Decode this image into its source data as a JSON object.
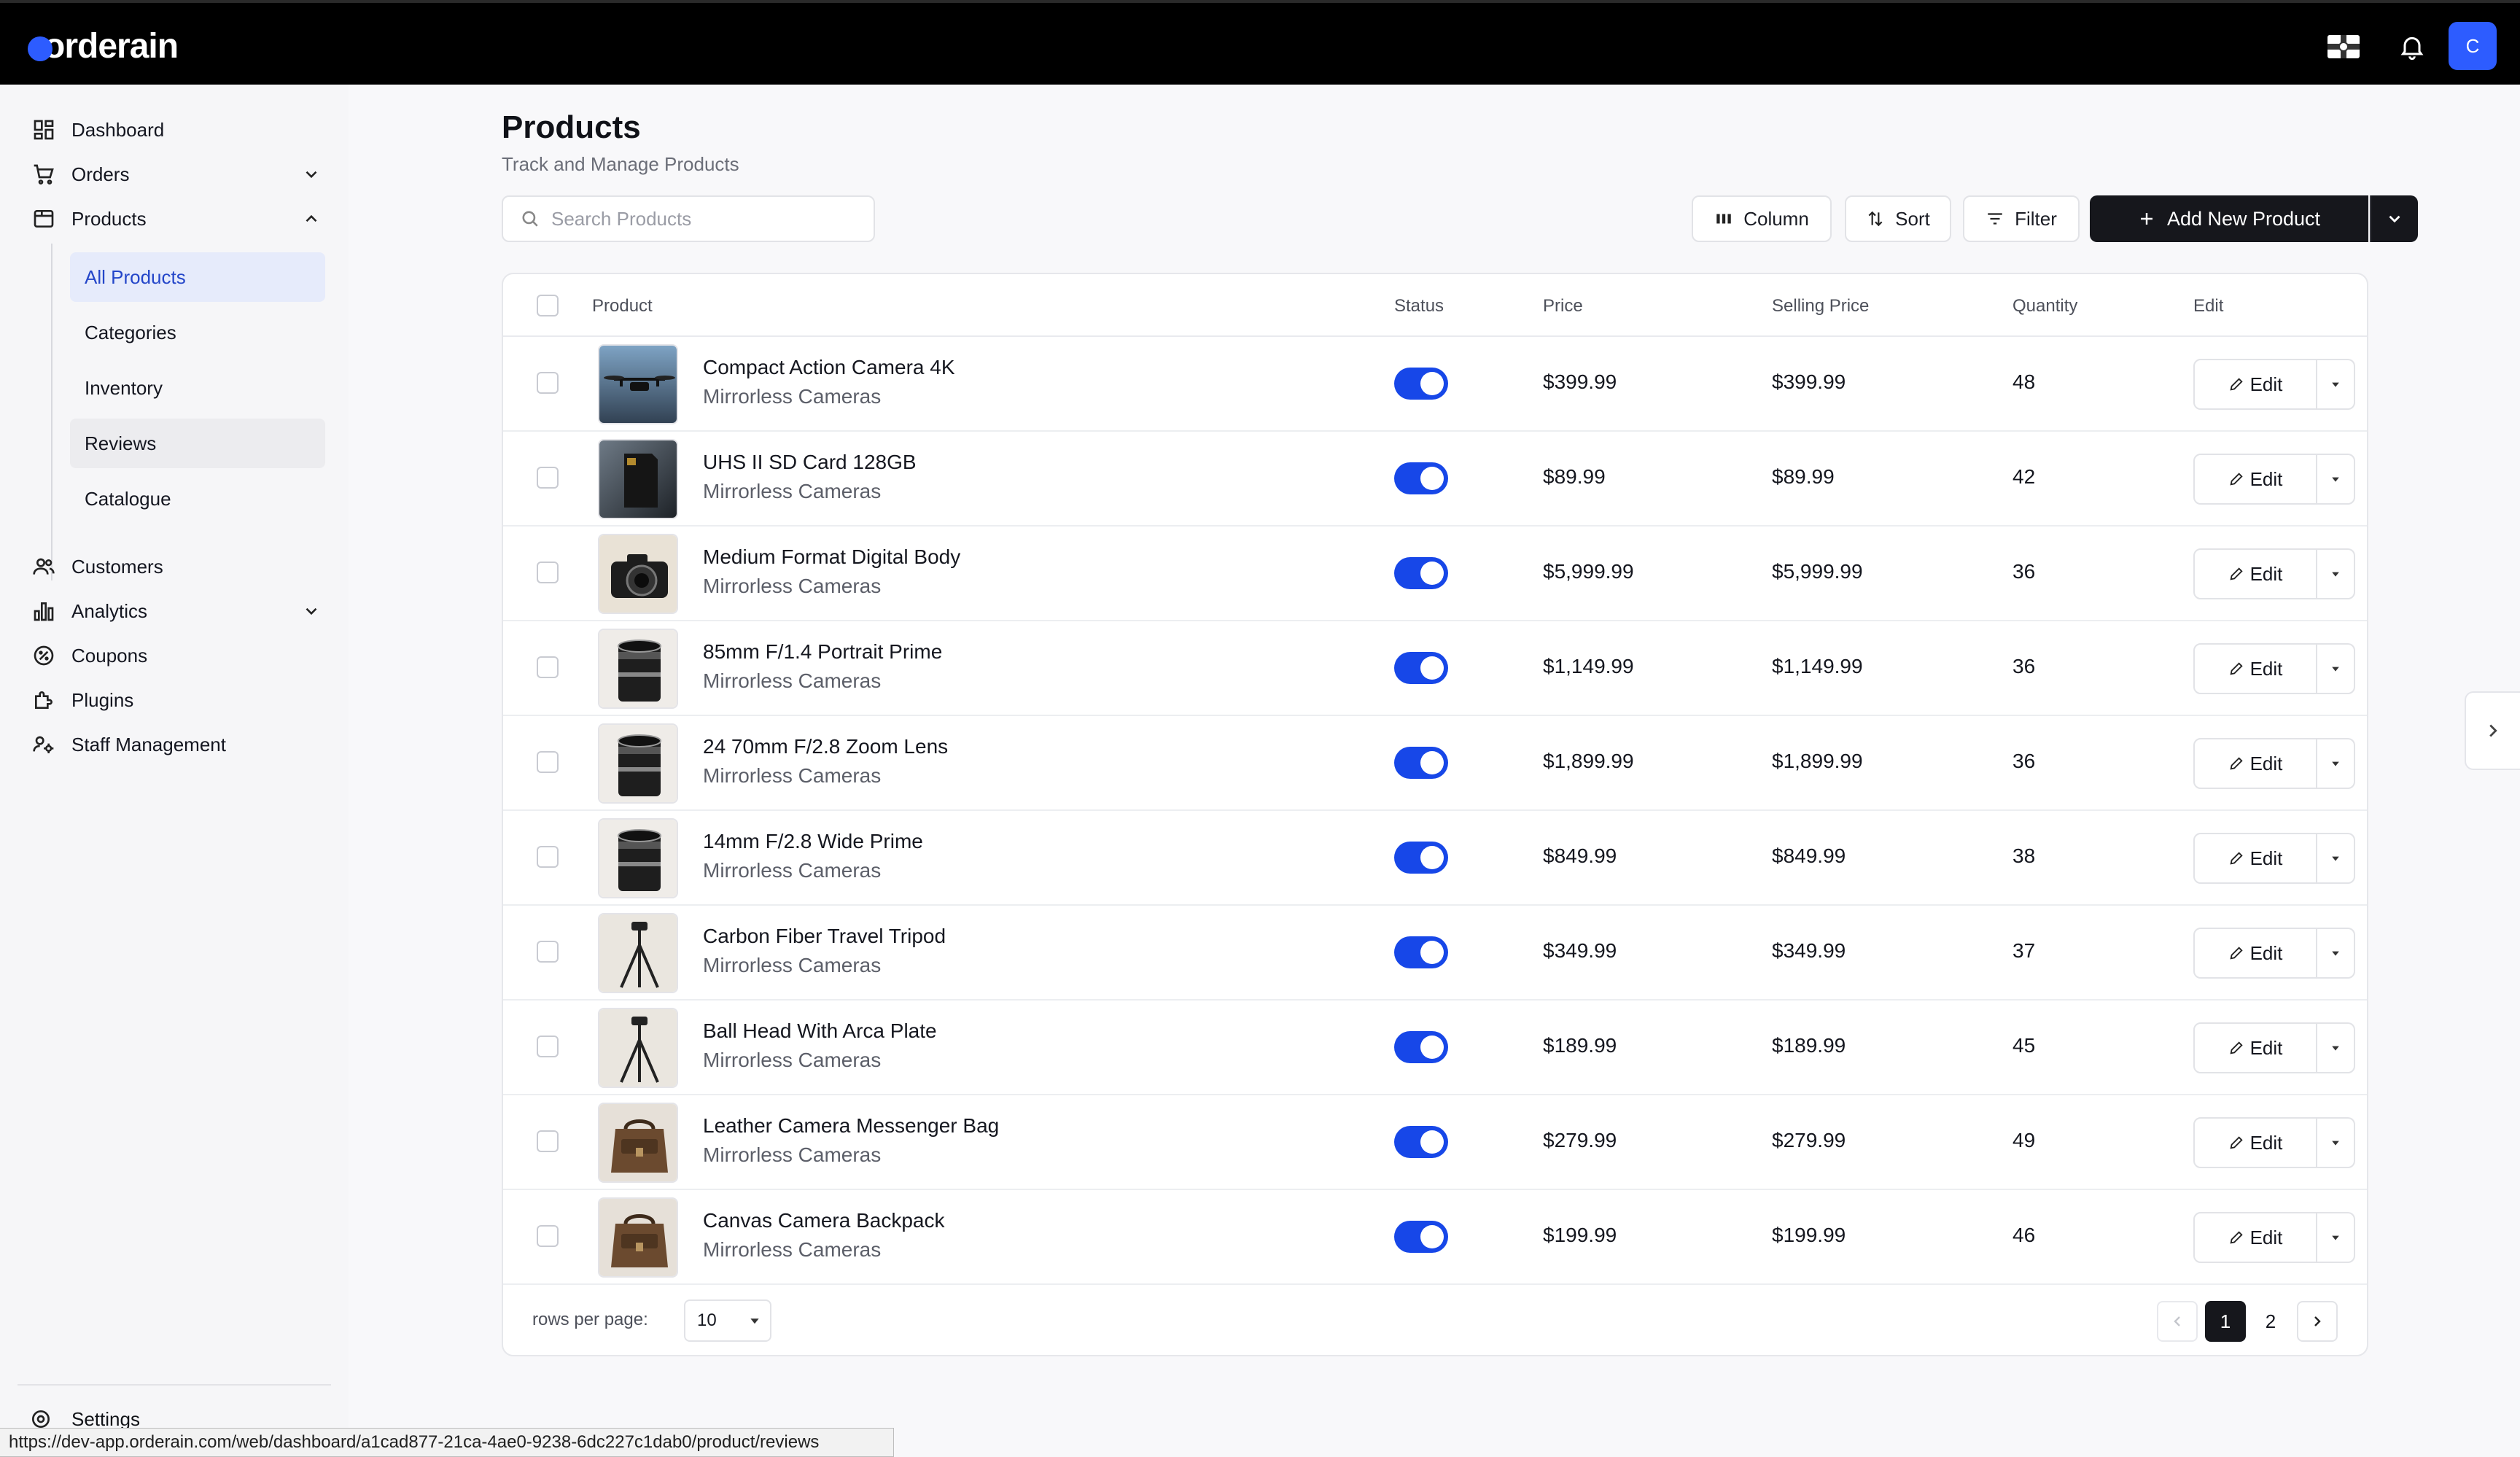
{
  "app": {
    "logo": "orderain",
    "avatar_initial": "C",
    "brand_color": "#2d5cff",
    "accent_color": "#1747e8"
  },
  "sidebar": {
    "items": [
      {
        "label": "Dashboard",
        "icon": "dashboard-icon"
      },
      {
        "label": "Orders",
        "icon": "cart-icon",
        "expandable": true
      },
      {
        "label": "Products",
        "icon": "box-icon",
        "expandable": true,
        "expanded": true
      },
      {
        "label": "Customers",
        "icon": "users-icon"
      },
      {
        "label": "Analytics",
        "icon": "bar-chart-icon",
        "expandable": true
      },
      {
        "label": "Coupons",
        "icon": "coupon-icon"
      },
      {
        "label": "Plugins",
        "icon": "puzzle-icon"
      },
      {
        "label": "Staff Management",
        "icon": "staff-icon"
      }
    ],
    "product_subitems": [
      "All Products",
      "Categories",
      "Inventory",
      "Reviews",
      "Catalogue"
    ],
    "active_subitem": "All Products",
    "settings_label": "Settings"
  },
  "status_bar_url": "https://dev-app.orderain.com/web/dashboard/a1cad877-21ca-4ae0-9238-6dc227c1dab0/product/reviews",
  "page": {
    "title": "Products",
    "subtitle": "Track and Manage Products"
  },
  "toolbar": {
    "search_placeholder": "Search Products",
    "column_label": "Column",
    "sort_label": "Sort",
    "filter_label": "Filter",
    "add_label": "Add New Product"
  },
  "table": {
    "headers": {
      "product": "Product",
      "status": "Status",
      "price": "Price",
      "selling_price": "Selling Price",
      "quantity": "Quantity",
      "edit": "Edit"
    },
    "edit_label": "Edit",
    "rows": [
      {
        "name": "Compact Action Camera 4K",
        "category": "Mirrorless Cameras",
        "status": true,
        "price": "$399.99",
        "selling_price": "$399.99",
        "quantity": "48",
        "thumb": "drone"
      },
      {
        "name": "UHS II SD Card 128GB",
        "category": "Mirrorless Cameras",
        "status": true,
        "price": "$89.99",
        "selling_price": "$89.99",
        "quantity": "42",
        "thumb": "sdcard"
      },
      {
        "name": "Medium Format Digital Body",
        "category": "Mirrorless Cameras",
        "status": true,
        "price": "$5,999.99",
        "selling_price": "$5,999.99",
        "quantity": "36",
        "thumb": "camera"
      },
      {
        "name": "85mm F/1.4 Portrait Prime",
        "category": "Mirrorless Cameras",
        "status": true,
        "price": "$1,149.99",
        "selling_price": "$1,149.99",
        "quantity": "36",
        "thumb": "lens"
      },
      {
        "name": "24 70mm F/2.8 Zoom Lens",
        "category": "Mirrorless Cameras",
        "status": true,
        "price": "$1,899.99",
        "selling_price": "$1,899.99",
        "quantity": "36",
        "thumb": "lens"
      },
      {
        "name": "14mm F/2.8 Wide Prime",
        "category": "Mirrorless Cameras",
        "status": true,
        "price": "$849.99",
        "selling_price": "$849.99",
        "quantity": "38",
        "thumb": "lens"
      },
      {
        "name": "Carbon Fiber Travel Tripod",
        "category": "Mirrorless Cameras",
        "status": true,
        "price": "$349.99",
        "selling_price": "$349.99",
        "quantity": "37",
        "thumb": "tripod"
      },
      {
        "name": "Ball Head With Arca Plate",
        "category": "Mirrorless Cameras",
        "status": true,
        "price": "$189.99",
        "selling_price": "$189.99",
        "quantity": "45",
        "thumb": "tripod"
      },
      {
        "name": "Leather Camera Messenger Bag",
        "category": "Mirrorless Cameras",
        "status": true,
        "price": "$279.99",
        "selling_price": "$279.99",
        "quantity": "49",
        "thumb": "bag"
      },
      {
        "name": "Canvas Camera Backpack",
        "category": "Mirrorless Cameras",
        "status": true,
        "price": "$199.99",
        "selling_price": "$199.99",
        "quantity": "46",
        "thumb": "bag"
      }
    ]
  },
  "pagination": {
    "rows_per_page_label": "rows per page:",
    "rows_per_page": "10",
    "pages": [
      "1",
      "2"
    ],
    "current_page": "1"
  }
}
